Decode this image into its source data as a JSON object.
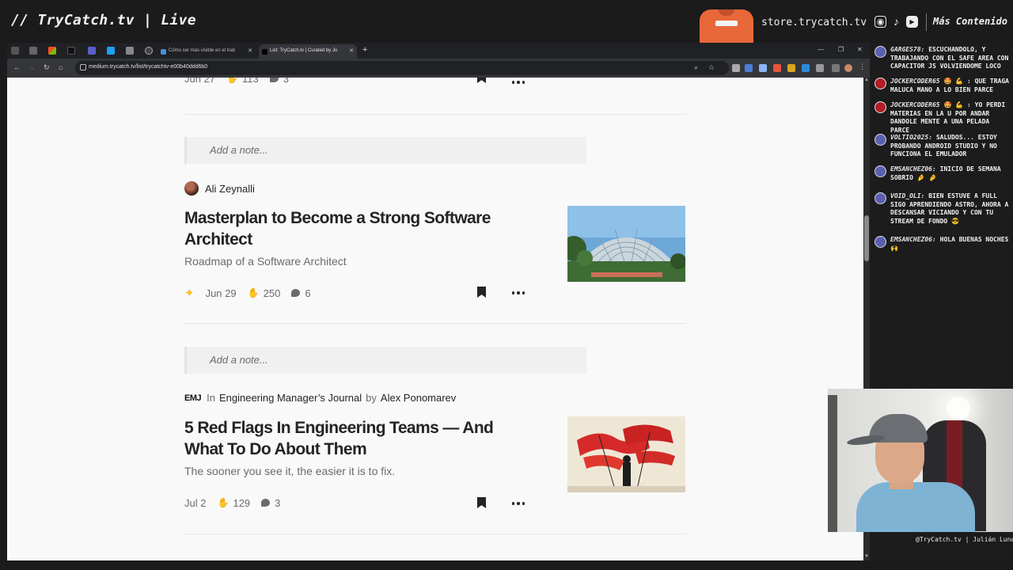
{
  "stream": {
    "brand": "// TryCatch.tv | Live",
    "store": "store.trycatch.tv",
    "more": "Más Contenido",
    "cam_caption": "@TryCatch.tv | Julián Luna"
  },
  "browser": {
    "tabs": [
      {
        "label": "Cómo ser más visible en el trab"
      },
      {
        "label": "List: TryCatch.tv | Curated by Ju"
      }
    ],
    "url": "medium.trycatch.tv/list/trycatchtv-e00b40ddd6b0"
  },
  "page": {
    "top_meta": {
      "date": "Jun 27",
      "claps": "113",
      "comments": "3"
    },
    "note_placeholder": "Add a note...",
    "articles": [
      {
        "author": "Ali Zeynalli",
        "title": "Masterplan to Become a Strong Software Architect",
        "subtitle": "Roadmap of a Software Architect",
        "date": "Jun 29",
        "claps": "250",
        "comments": "6"
      },
      {
        "pub_mark": "EMJ",
        "in_word": "In",
        "publication": "Engineering Manager’s Journal",
        "by_word": "by",
        "author": "Alex Ponomarev",
        "title": "5 Red Flags In Engineering Teams — And What To Do About Them",
        "subtitle": "The sooner you see it, the easier it is to fix.",
        "date": "Jul 2",
        "claps": "129",
        "comments": "3"
      }
    ]
  },
  "chat": [
    {
      "user": "GARGES78:",
      "text": "ESCUCHANDOLO, Y TRABAJANDO CON EL SAFE AREA CON CAPACITOR JS VOLVIENDOME LOCO",
      "badge": "purple"
    },
    {
      "user": "JOCKERCODER65",
      "text": "🤩 💪 : QUE TRAGA MALUCA MANO A LO BIEN PARCE",
      "badge": "red"
    },
    {
      "user": "JOCKERCODER65",
      "text": "🤩 💪 : YO PERDI MATERIAS EN LA U POR ANDAR DANDOLE MENTE A UNA PELADA PARCE",
      "badge": "red"
    },
    {
      "user": "VOLTIO2025:",
      "text": "SALUDOS... ESTOY PROBANDO ANDROID STUDIO Y NO FUNCIONA EL EMULADOR",
      "badge": "purple"
    },
    {
      "user": "EMSANCHEZ06:",
      "text": "INICIO DE SEMANA SOBRIO 🤌 🤌",
      "badge": "purple"
    },
    {
      "user": "VOID_OLI:",
      "text": "BIEN ESTUVE A FULL SIGO APRENDIENDO ASTRO, AHORA A DESCANSAR VICIANDO Y CON TU STREAM DE FONDO 😎",
      "badge": "purple"
    },
    {
      "user": "EMSANCHEZ06:",
      "text": "HOLA BUENAS NOCHES 🙌",
      "badge": "purple"
    }
  ]
}
